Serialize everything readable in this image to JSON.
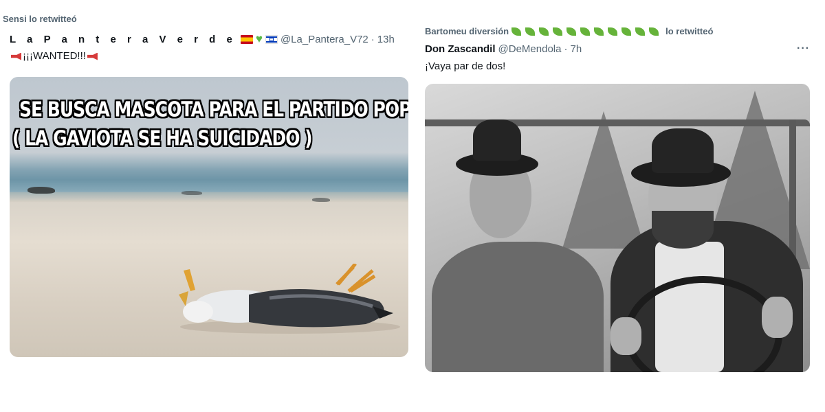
{
  "left_tweet": {
    "retweet_text": "Sensi lo retwitteó",
    "display_name": "L a P a n t e r a V e r d e",
    "handle": "@La_Pantera_V72",
    "separator": "·",
    "time": "13h",
    "text": "¡¡¡WANTED!!!",
    "meme_line_1": "SE BUSCA MASCOTA PARA EL PARTIDO POPULAR",
    "meme_line_2": "( LA GAVIOTA SE HA SUICIDADO )"
  },
  "right_tweet": {
    "retweeter_name": "Bartomeu diversión",
    "retweet_suffix": "lo retwitteó",
    "display_name": "Don Zascandil",
    "handle": "@DeMendola",
    "separator": "·",
    "time": "7h",
    "more_label": "···",
    "text": "¡Vaya par de dos!"
  }
}
